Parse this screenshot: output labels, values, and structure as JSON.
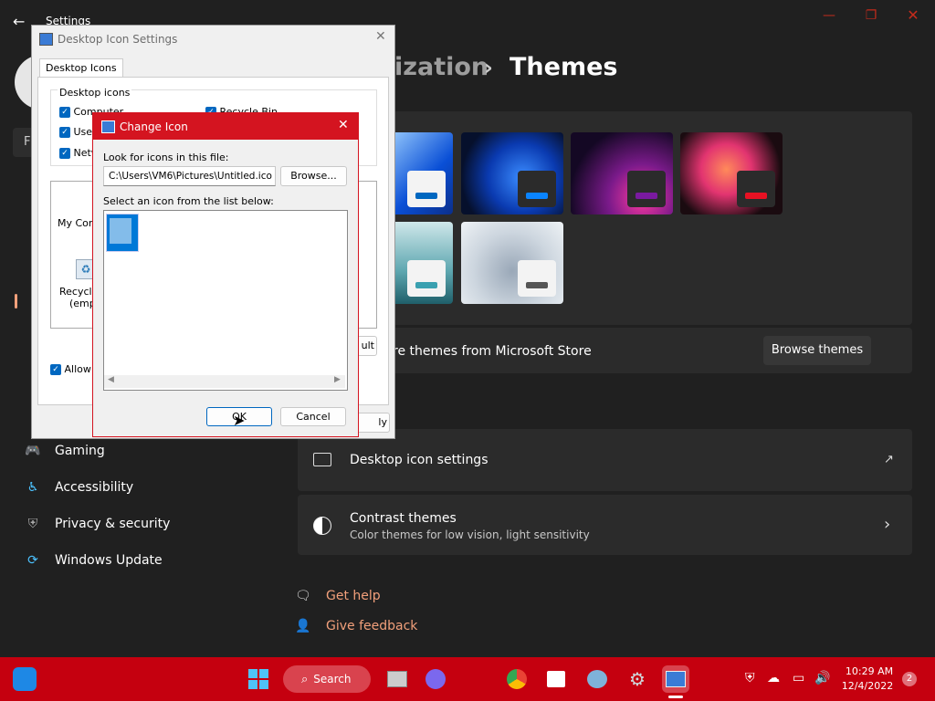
{
  "settings": {
    "app_title": "Settings",
    "breadcrumb_parent": "ization",
    "breadcrumb_sep": "›",
    "breadcrumb_current": "Themes",
    "nav_items": [
      {
        "label": "Gaming",
        "icon": "gamepad-icon"
      },
      {
        "label": "Accessibility",
        "icon": "accessibility-icon"
      },
      {
        "label": "Privacy & security",
        "icon": "shield-icon"
      },
      {
        "label": "Windows Update",
        "icon": "update-icon"
      }
    ],
    "store_text": "re themes from Microsoft Store",
    "browse_themes": "Browse themes",
    "desktop_icon_settings": "Desktop icon settings",
    "contrast_title": "Contrast themes",
    "contrast_sub": "Color themes for low vision, light sensitivity",
    "get_help": "Get help",
    "give_feedback": "Give feedback",
    "accent": "#f2a07b"
  },
  "desktop_icon_dialog": {
    "title": "Desktop Icon Settings",
    "tab": "Desktop Icons",
    "group": "Desktop icons",
    "checks": [
      "Computer",
      "User",
      "Netw",
      "Recycle Bin"
    ],
    "icon_labels": [
      "My Com",
      "Recycle",
      "(empt"
    ],
    "allow_text": "Allow t",
    "default_btn": "ult",
    "apply_btn": "ly"
  },
  "change_icon_dialog": {
    "title": "Change Icon",
    "look_label": "Look for icons in this file:",
    "path_value": "C:\\Users\\VM6\\Pictures\\Untitled.ico",
    "browse": "Browse...",
    "select_label": "Select an icon from the list below:",
    "ok": "OK",
    "cancel": "Cancel"
  },
  "taskbar": {
    "search": "Search",
    "time": "10:29 AM",
    "date": "12/4/2022",
    "notifications": "2"
  }
}
